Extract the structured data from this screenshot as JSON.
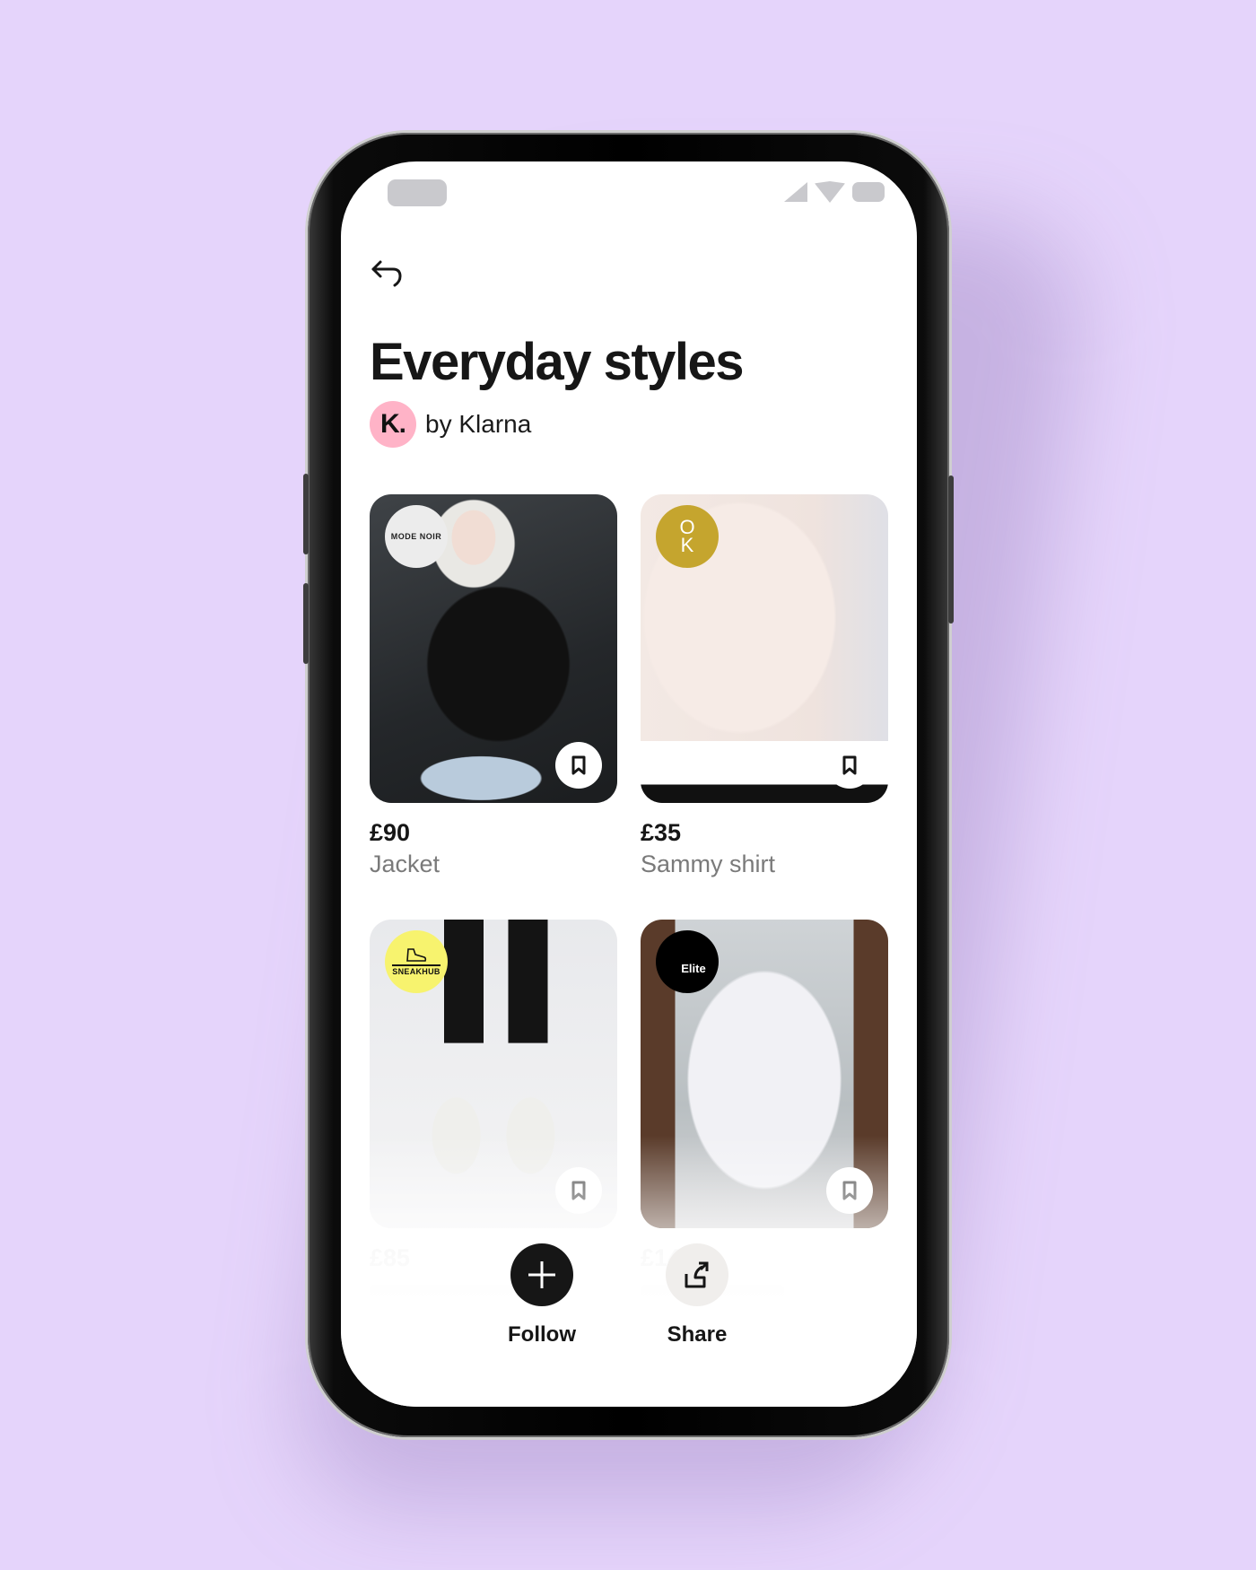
{
  "theme": {
    "background": "#E5D4FB",
    "klarna_pink": "#FFB3C7",
    "text_primary": "#161616",
    "text_secondary": "#7a7a7a"
  },
  "status_bar": {
    "icons": [
      "signal-icon",
      "wifi-icon",
      "battery-icon"
    ]
  },
  "header": {
    "back_icon": "back-arrow-icon",
    "title": "Everyday styles",
    "author_badge": "K.",
    "byline": "by Klarna"
  },
  "products": [
    {
      "price": "£90",
      "name": "Jacket",
      "brand": "MODE NOIR",
      "image": "woman in black leather jacket"
    },
    {
      "price": "£35",
      "name": "Sammy shirt",
      "brand": "O K",
      "image": "cream sweatshirt over white shirt"
    },
    {
      "price": "£85",
      "name": "",
      "brand": "SNEAKHUB",
      "image": "white sneakers with black trousers"
    },
    {
      "price": "£14",
      "name": "",
      "brand": "Elite",
      "image": "man in white t-shirt"
    }
  ],
  "actions": {
    "follow_label": "Follow",
    "share_label": "Share"
  }
}
